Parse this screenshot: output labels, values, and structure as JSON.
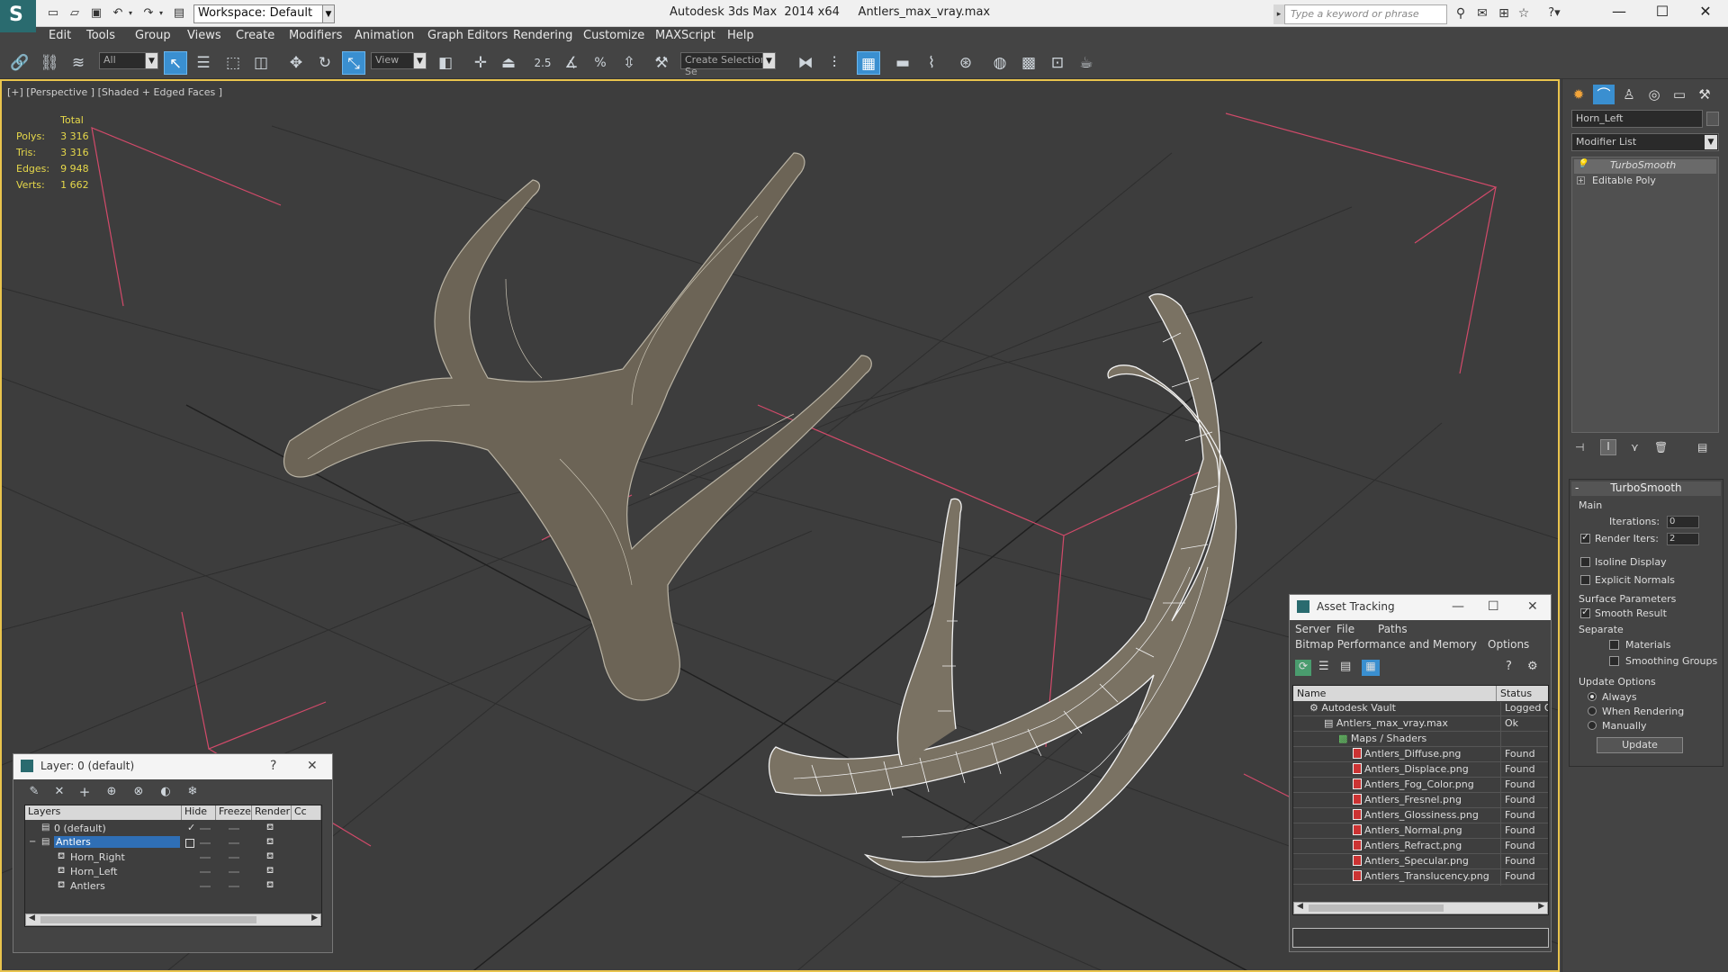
{
  "app": {
    "title": "Autodesk 3ds Max  2014 x64     Antlers_max_vray.max",
    "workspace": "Workspace: Default",
    "search_placeholder": "Type a keyword or phrase"
  },
  "menu": [
    "Edit",
    "Tools",
    "Group",
    "Views",
    "Create",
    "Modifiers",
    "Animation",
    "Graph Editors",
    "Rendering",
    "Customize",
    "MAXScript",
    "Help"
  ],
  "toolbar": {
    "selection_filter": "All",
    "ref_coord": "View",
    "snap_label": "2.5",
    "named_selection": "Create Selection Se"
  },
  "viewport": {
    "label": "[+] [Perspective ] [Shaded + Edged Faces ]",
    "stats": {
      "header": "Total",
      "rows": [
        {
          "label": "Polys:",
          "value": "3 316"
        },
        {
          "label": "Tris:",
          "value": "3 316"
        },
        {
          "label": "Edges:",
          "value": "9 948"
        },
        {
          "label": "Verts:",
          "value": "1 662"
        }
      ]
    }
  },
  "command_panel": {
    "object_name": "Horn_Left",
    "modifier_list": "Modifier List",
    "stack": [
      "TurboSmooth",
      "Editable Poly"
    ],
    "turbosmooth": {
      "title": "TurboSmooth",
      "main": "Main",
      "iterations_label": "Iterations:",
      "iterations": "0",
      "render_iters_label": "Render Iters:",
      "render_iters": "2",
      "isoline": "Isoline Display",
      "explicit_normals": "Explicit Normals",
      "surface_params": "Surface Parameters",
      "smooth_result": "Smooth Result",
      "separate": "Separate",
      "materials": "Materials",
      "smoothing_groups": "Smoothing Groups",
      "update_options": "Update Options",
      "always": "Always",
      "when_rendering": "When Rendering",
      "manually": "Manually",
      "update_button": "Update"
    }
  },
  "layer_dialog": {
    "title": "Layer: 0 (default)",
    "help": "?",
    "columns": [
      "Layers",
      "Hide",
      "Freeze",
      "Render",
      "Cc"
    ],
    "rows": [
      {
        "name": "0 (default)",
        "indent": 0
      },
      {
        "name": "Antlers",
        "indent": 0
      },
      {
        "name": "Horn_Right",
        "indent": 1
      },
      {
        "name": "Horn_Left",
        "indent": 1
      },
      {
        "name": "Antlers",
        "indent": 1
      }
    ]
  },
  "asset_dialog": {
    "title": "Asset Tracking",
    "menu": [
      "Server",
      "File",
      "Paths"
    ],
    "menu2": [
      "Bitmap Performance and Memory",
      "Options"
    ],
    "columns": [
      "Name",
      "Status"
    ],
    "rows": [
      {
        "name": "Autodesk Vault",
        "status": "Logged Ou",
        "indent": 1
      },
      {
        "name": "Antlers_max_vray.max",
        "status": "Ok",
        "indent": 2
      },
      {
        "name": "Maps / Shaders",
        "status": "",
        "indent": 3
      },
      {
        "name": "Antlers_Diffuse.png",
        "status": "Found",
        "indent": 4
      },
      {
        "name": "Antlers_Displace.png",
        "status": "Found",
        "indent": 4
      },
      {
        "name": "Antlers_Fog_Color.png",
        "status": "Found",
        "indent": 4
      },
      {
        "name": "Antlers_Fresnel.png",
        "status": "Found",
        "indent": 4
      },
      {
        "name": "Antlers_Glossiness.png",
        "status": "Found",
        "indent": 4
      },
      {
        "name": "Antlers_Normal.png",
        "status": "Found",
        "indent": 4
      },
      {
        "name": "Antlers_Refract.png",
        "status": "Found",
        "indent": 4
      },
      {
        "name": "Antlers_Specular.png",
        "status": "Found",
        "indent": 4
      },
      {
        "name": "Antlers_Translucency.png",
        "status": "Found",
        "indent": 4
      }
    ]
  },
  "colors": {
    "viewport_border": "#e9c44d",
    "selection_blue": "#2f6fb6",
    "stats_yellow": "#e6d84a",
    "bbox_pink": "#d24a6a"
  }
}
